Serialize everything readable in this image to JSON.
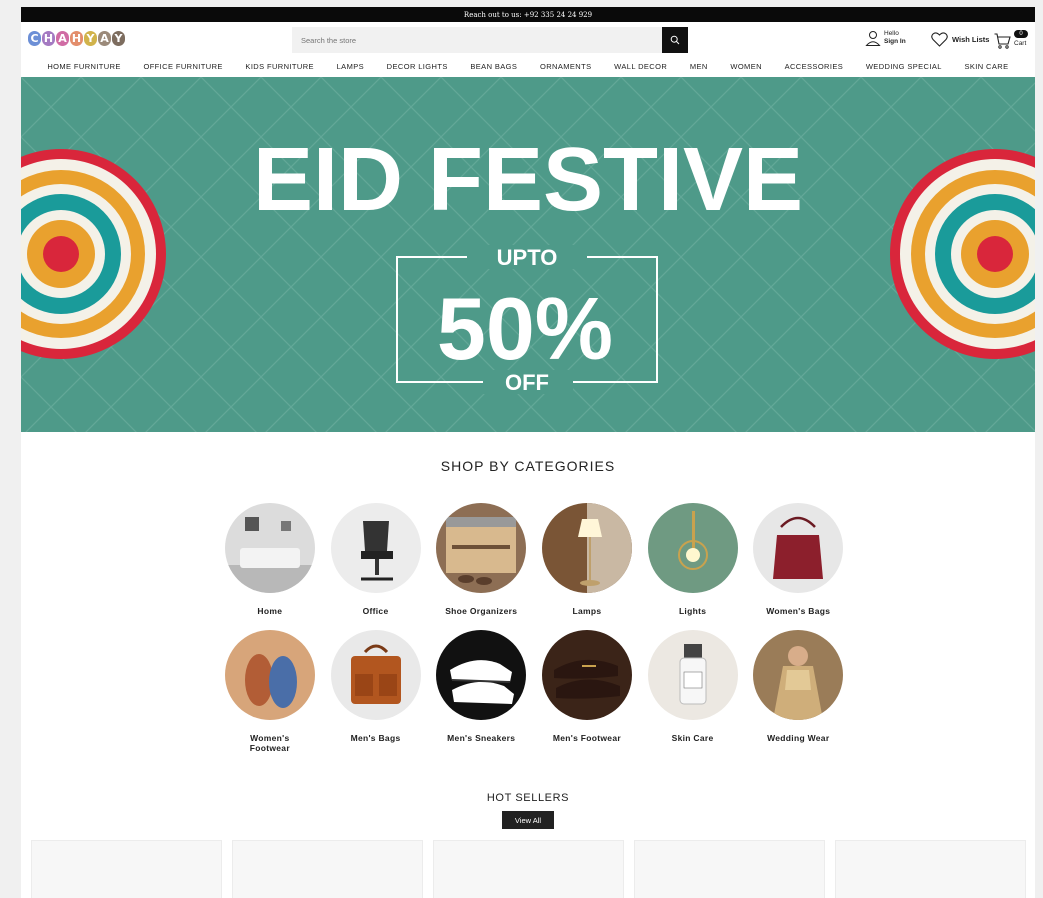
{
  "topbar": {
    "text": "Reach out to us: +92 335 24 24 929"
  },
  "header": {
    "logo_letters": [
      {
        "ch": "C",
        "color": "#6c8fd6"
      },
      {
        "ch": "H",
        "color": "#a47ac2"
      },
      {
        "ch": "A",
        "color": "#d06ca4"
      },
      {
        "ch": "H",
        "color": "#e38e6c"
      },
      {
        "ch": "Y",
        "color": "#d1b34b"
      },
      {
        "ch": "A",
        "color": "#9b8a7a"
      },
      {
        "ch": "Y",
        "color": "#7d6d5f"
      }
    ],
    "search_placeholder": "Search the store",
    "account_hello": "Hello",
    "account_signin": "Sign In",
    "wishlist_label": "Wish Lists",
    "cart_count": "0",
    "cart_label": "Cart"
  },
  "nav": {
    "items": [
      "HOME FURNITURE",
      "OFFICE FURNITURE",
      "KIDS FURNITURE",
      "LAMPS",
      "DECOR LIGHTS",
      "BEAN BAGS",
      "ORNAMENTS",
      "WALL DECOR",
      "MEN",
      "WOMEN",
      "ACCESSORIES",
      "WEDDING SPECIAL",
      "SKIN CARE"
    ]
  },
  "banner": {
    "title": "EID FESTIVE",
    "upto": "UPTO",
    "percent": "50%",
    "off": "OFF",
    "bg_color": "#4e9a89"
  },
  "categories": {
    "heading": "SHOP BY CATEGORIES",
    "items": [
      {
        "label": "Home",
        "icon": "home-furniture"
      },
      {
        "label": "Office",
        "icon": "office-chair"
      },
      {
        "label": "Shoe Organizers",
        "icon": "shoe-organizer"
      },
      {
        "label": "Lamps",
        "icon": "floor-lamp"
      },
      {
        "label": "Lights",
        "icon": "wall-light"
      },
      {
        "label": "Women's Bags",
        "icon": "womens-bag"
      },
      {
        "label": "Women's Footwear",
        "icon": "womens-footwear"
      },
      {
        "label": "Men's Bags",
        "icon": "mens-bag"
      },
      {
        "label": "Men's Sneakers",
        "icon": "sneakers"
      },
      {
        "label": "Men's Footwear",
        "icon": "mens-loafer"
      },
      {
        "label": "Skin Care",
        "icon": "serum-bottle"
      },
      {
        "label": "Wedding Wear",
        "icon": "bridal-dress"
      }
    ]
  },
  "hot_sellers": {
    "heading": "HOT SELLERS",
    "view_all": "View All"
  }
}
